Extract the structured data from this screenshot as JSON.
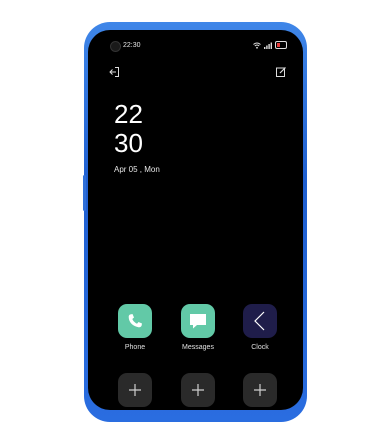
{
  "status_bar": {
    "time": "22:30",
    "battery_color": "#e83b3b"
  },
  "lock_clock": {
    "hours": "22",
    "minutes": "30",
    "date": "Apr 05 , Mon"
  },
  "apps": [
    {
      "label": "Phone",
      "icon": "phone-icon",
      "color": "#62c9a7"
    },
    {
      "label": "Messages",
      "icon": "message-icon",
      "color": "#62c9a7"
    },
    {
      "label": "Clock",
      "icon": "clock-hands-icon",
      "color": "#1f1d4a"
    }
  ],
  "add_slots": [
    {
      "icon": "plus-icon"
    },
    {
      "icon": "plus-icon"
    },
    {
      "icon": "plus-icon"
    }
  ],
  "icons": {
    "top_left": "exit-icon",
    "top_right": "edit-icon"
  }
}
